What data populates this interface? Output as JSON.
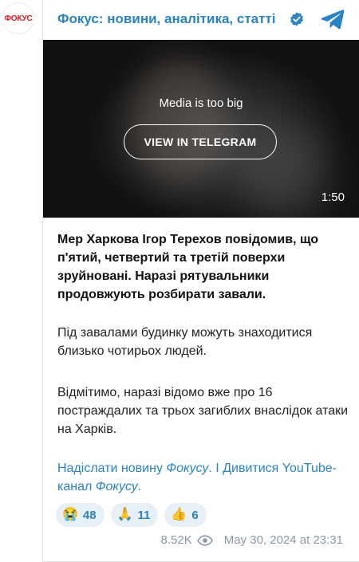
{
  "channel": {
    "name": "Фокус: новини, аналітика, статті",
    "avatar_text": "ФОКУС"
  },
  "media": {
    "note": "Media is too big",
    "button_label": "VIEW IN TELEGRAM",
    "duration": "1:50"
  },
  "post": {
    "paragraph_1": "Мер Харкова Ігор Терехов повідомив, що п'ятий, четвертий та третій поверхи зруйновані. Наразі рятувальники продовжують розбирати завали.",
    "paragraph_2": "Під завалами будинку можуть знаходитися близько чотирьох людей.",
    "paragraph_3": "Відмітимо, наразі відомо вже про 16 постраждалих та трьох загиблих внаслідок атаки на Харків.",
    "link_1_text": "Надіслати новину ",
    "link_1_italic": "Фокусу",
    "link_1_end": ".",
    "separator": " І ",
    "link_2_text": "Дивитися YouTube-канал ",
    "link_2_italic": "Фокусу",
    "link_2_end": "."
  },
  "reactions": [
    {
      "emoji": "😭",
      "icon": "crying-face-icon",
      "count": "48"
    },
    {
      "emoji": "🙏",
      "icon": "praying-hands-icon",
      "count": "11"
    },
    {
      "emoji": "👍",
      "icon": "thumbs-up-icon",
      "count": "6"
    }
  ],
  "footer": {
    "views": "8.52K",
    "date": "May 30, 2024 at 23:31"
  },
  "colors": {
    "link": "#2a83c4",
    "brand_red": "#e11b22",
    "reaction_bg": "#e8f0f7",
    "meta": "#8a98a8"
  }
}
